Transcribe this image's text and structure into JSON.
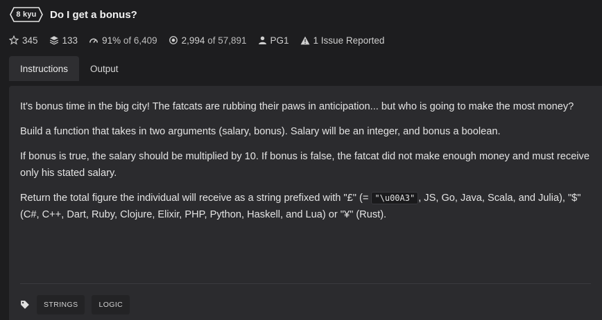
{
  "kata": {
    "rank": "8 kyu",
    "title": "Do I get a bonus?"
  },
  "stats": {
    "stars": "345",
    "collections": "133",
    "satisfaction": "91%",
    "satisfaction_of": "of 6,409",
    "completions": "2,994",
    "completions_of": "of 57,891",
    "author": "PG1",
    "issues": "1 Issue Reported"
  },
  "tabs": [
    {
      "label": "Instructions",
      "active": true
    },
    {
      "label": "Output",
      "active": false
    }
  ],
  "description": {
    "p1": "It's bonus time in the big city! The fatcats are rubbing their paws in anticipation... but who is going to make the most money?",
    "p2": "Build a function that takes in two arguments (salary, bonus). Salary will be an integer, and bonus a boolean.",
    "p3": "If bonus is true, the salary should be multiplied by 10. If bonus is false, the fatcat did not make enough money and must receive only his stated salary.",
    "p4_before": "Return the total figure the individual will receive as a string prefixed with \"£\" (= ",
    "p4_code": "\"\\u00A3\"",
    "p4_after": ", JS, Go, Java, Scala, and Julia), \"$\" (C#, C++, Dart, Ruby, Clojure, Elixir, PHP, Python, Haskell, and Lua) or \"¥\" (Rust)."
  },
  "tags": [
    "STRINGS",
    "LOGIC"
  ],
  "colors": {
    "background": "#1d1d1f",
    "panel": "#2b2b2e",
    "active_tab": "#2e2e31"
  }
}
